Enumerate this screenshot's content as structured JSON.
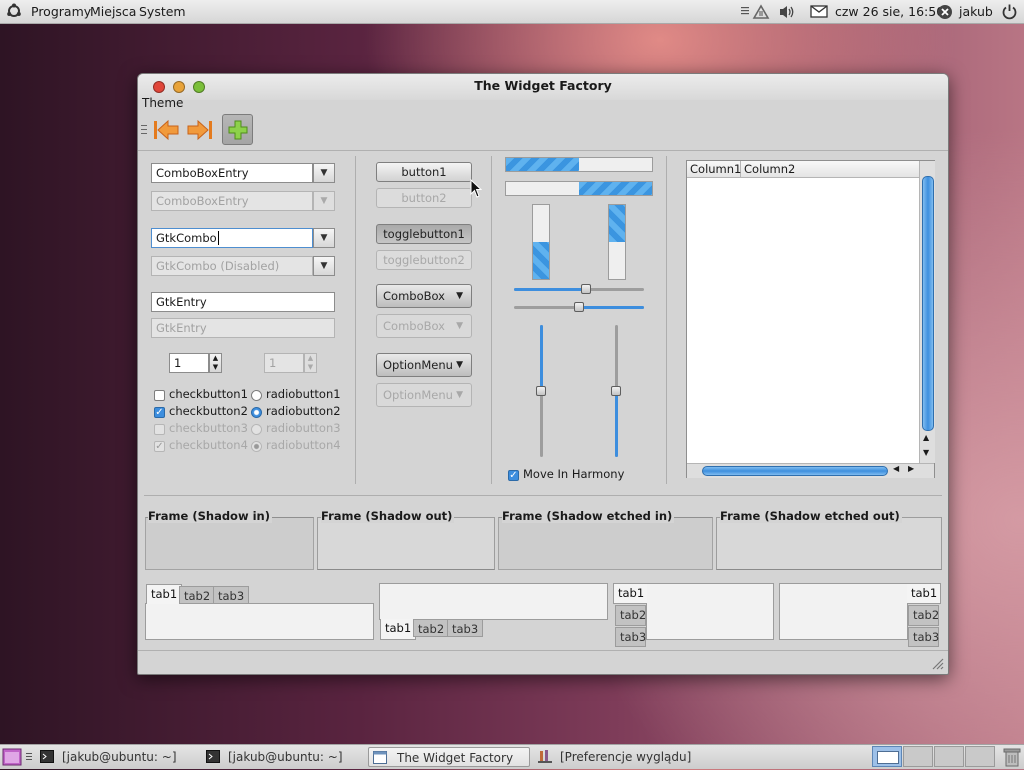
{
  "top_panel": {
    "menus": [
      "Programy",
      "Miejsca",
      "System"
    ],
    "clock": "czw 26 sie, 16:50",
    "user": "jakub"
  },
  "window": {
    "title": "The Widget Factory",
    "menu": "Theme"
  },
  "col1": {
    "comboboxentry": "ComboBoxEntry",
    "comboboxentry_disabled": "ComboBoxEntry",
    "gtkcombo": "GtkCombo",
    "gtkcombo_disabled": "GtkCombo (Disabled)",
    "entry": "GtkEntry",
    "entry_disabled": "GtkEntry",
    "spin": "1",
    "spin_disabled": "1",
    "checks": [
      {
        "label": "checkbutton1",
        "checked": false,
        "disabled": false
      },
      {
        "label": "checkbutton2",
        "checked": true,
        "disabled": false
      },
      {
        "label": "checkbutton3",
        "checked": false,
        "disabled": true
      },
      {
        "label": "checkbutton4",
        "checked": true,
        "disabled": true
      }
    ],
    "radios": [
      {
        "label": "radiobutton1",
        "selected": false,
        "disabled": false
      },
      {
        "label": "radiobutton2",
        "selected": true,
        "disabled": false
      },
      {
        "label": "radiobutton3",
        "selected": false,
        "disabled": true
      },
      {
        "label": "radiobutton4",
        "selected": true,
        "disabled": true
      }
    ]
  },
  "col2": {
    "button1": "button1",
    "button2": "button2",
    "toggle1": "togglebutton1",
    "toggle2": "togglebutton2",
    "combobox": "ComboBox",
    "combobox_disabled": "ComboBox",
    "optionmenu": "OptionMenu",
    "optionmenu_disabled": "OptionMenu"
  },
  "col3": {
    "progress_h1": 0.5,
    "progress_h2": 0.5,
    "progress_v1": 0.5,
    "progress_v2": 0.5,
    "hscale1": 0.55,
    "hscale2": 0.5,
    "vscale1": 0.5,
    "vscale2": 0.5,
    "move_in_harmony": "Move In Harmony",
    "move_in_harmony_checked": true
  },
  "tree": {
    "columns": [
      "Column1",
      "Column2"
    ]
  },
  "frames": [
    "Frame (Shadow in)",
    "Frame (Shadow out)",
    "Frame (Shadow etched in)",
    "Frame (Shadow etched out)"
  ],
  "notebooks": [
    "tab1",
    "tab2",
    "tab3"
  ],
  "taskbar": [
    "[jakub@ubuntu: ~]",
    "[jakub@ubuntu: ~]",
    "The Widget Factory",
    "[Preferencje wyglądu]"
  ],
  "colors": {
    "accent": "#3d8ede",
    "accent_light": "#5fb2ef",
    "panel": "#e0e0e0",
    "window_bg": "#d4d4d4"
  }
}
